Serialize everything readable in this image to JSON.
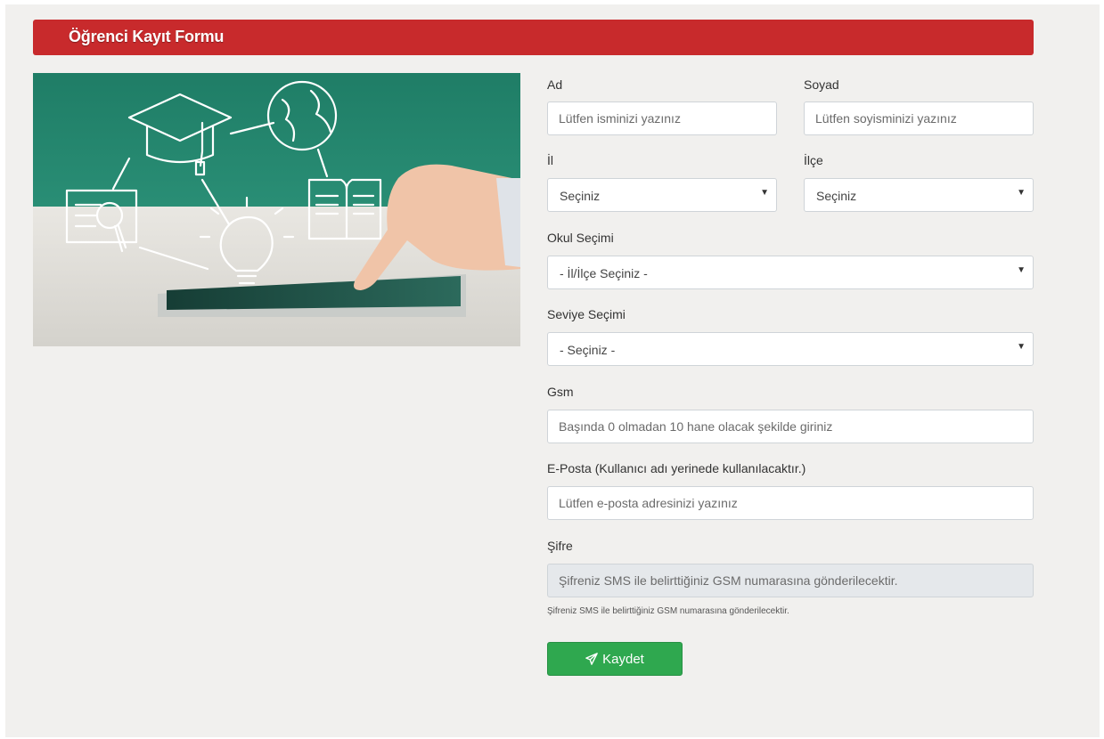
{
  "header": {
    "title": "Öğrenci Kayıt Formu"
  },
  "hero": {
    "icon_names": [
      "graduation-cap-icon",
      "globe-icon",
      "book-icon",
      "certificate-icon",
      "lightbulb-icon",
      "tablet-icon"
    ]
  },
  "form": {
    "ad": {
      "label": "Ad",
      "placeholder": "Lütfen isminizi yazınız"
    },
    "soyad": {
      "label": "Soyad",
      "placeholder": "Lütfen soyisminizi yazınız"
    },
    "il": {
      "label": "İl",
      "selected": "Seçiniz"
    },
    "ilce": {
      "label": "İlçe",
      "selected": "Seçiniz"
    },
    "okul": {
      "label": "Okul Seçimi",
      "selected": "- İl/İlçe Seçiniz -"
    },
    "seviye": {
      "label": "Seviye Seçimi",
      "selected": "- Seçiniz -"
    },
    "gsm": {
      "label": "Gsm",
      "placeholder": "Başında 0 olmadan 10 hane olacak şekilde giriniz"
    },
    "eposta": {
      "label": "E-Posta (Kullanıcı adı yerinede kullanılacaktır.)",
      "placeholder": "Lütfen e-posta adresinizi yazınız"
    },
    "sifre": {
      "label": "Şifre",
      "placeholder": "Şifreniz SMS ile belirttiğiniz GSM numarasına gönderilecektir.",
      "help": "Şifreniz SMS ile belirttiğiniz GSM numarasına gönderilecektir."
    },
    "submit": {
      "label": "Kaydet",
      "icon": "paper-plane-icon"
    }
  },
  "colors": {
    "header": "#c82a2c",
    "button": "#2fa84f",
    "background": "#f1f0ee"
  }
}
